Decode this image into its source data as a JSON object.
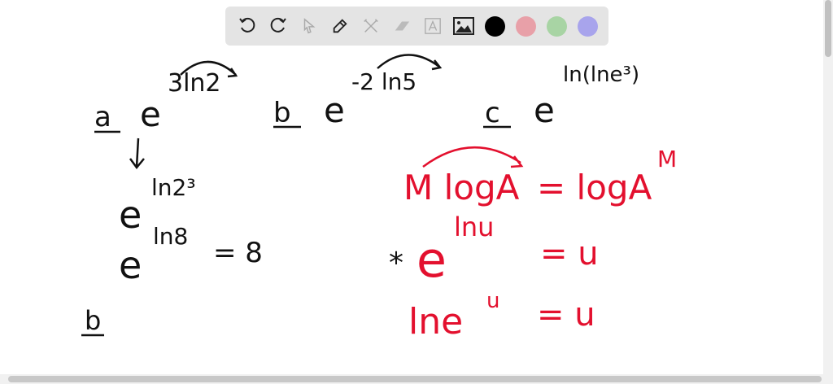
{
  "toolbar": {
    "tools": [
      "undo-icon",
      "redo-icon",
      "select-icon",
      "pen-icon",
      "tools-icon",
      "eraser-icon",
      "text-icon",
      "image-icon"
    ],
    "colors": [
      "#000000",
      "#e8a0a8",
      "#a8d4a4",
      "#a8a4ec"
    ]
  },
  "board": {
    "a_label": "a",
    "a_base": "e",
    "a_exp": "3ln2",
    "b_label": "b",
    "b_base": "e",
    "b_exp": "-2 ln5",
    "c_label": "c",
    "c_base": "e",
    "c_exp": "ln(lne³)",
    "step1_base": "e",
    "step1_exp": "ln2³",
    "step2_base": "e",
    "step2_exp": "ln8",
    "step2_result": "= 8",
    "b2_label": "b",
    "rule1_left": "M logA",
    "rule1_right": "= logA",
    "rule1_exp": "M",
    "rule2_star": "*",
    "rule2_base": "e",
    "rule2_exp": "lnu",
    "rule2_result": "= u",
    "rule3_left": "lne",
    "rule3_exp": "u",
    "rule3_result": "= u"
  }
}
